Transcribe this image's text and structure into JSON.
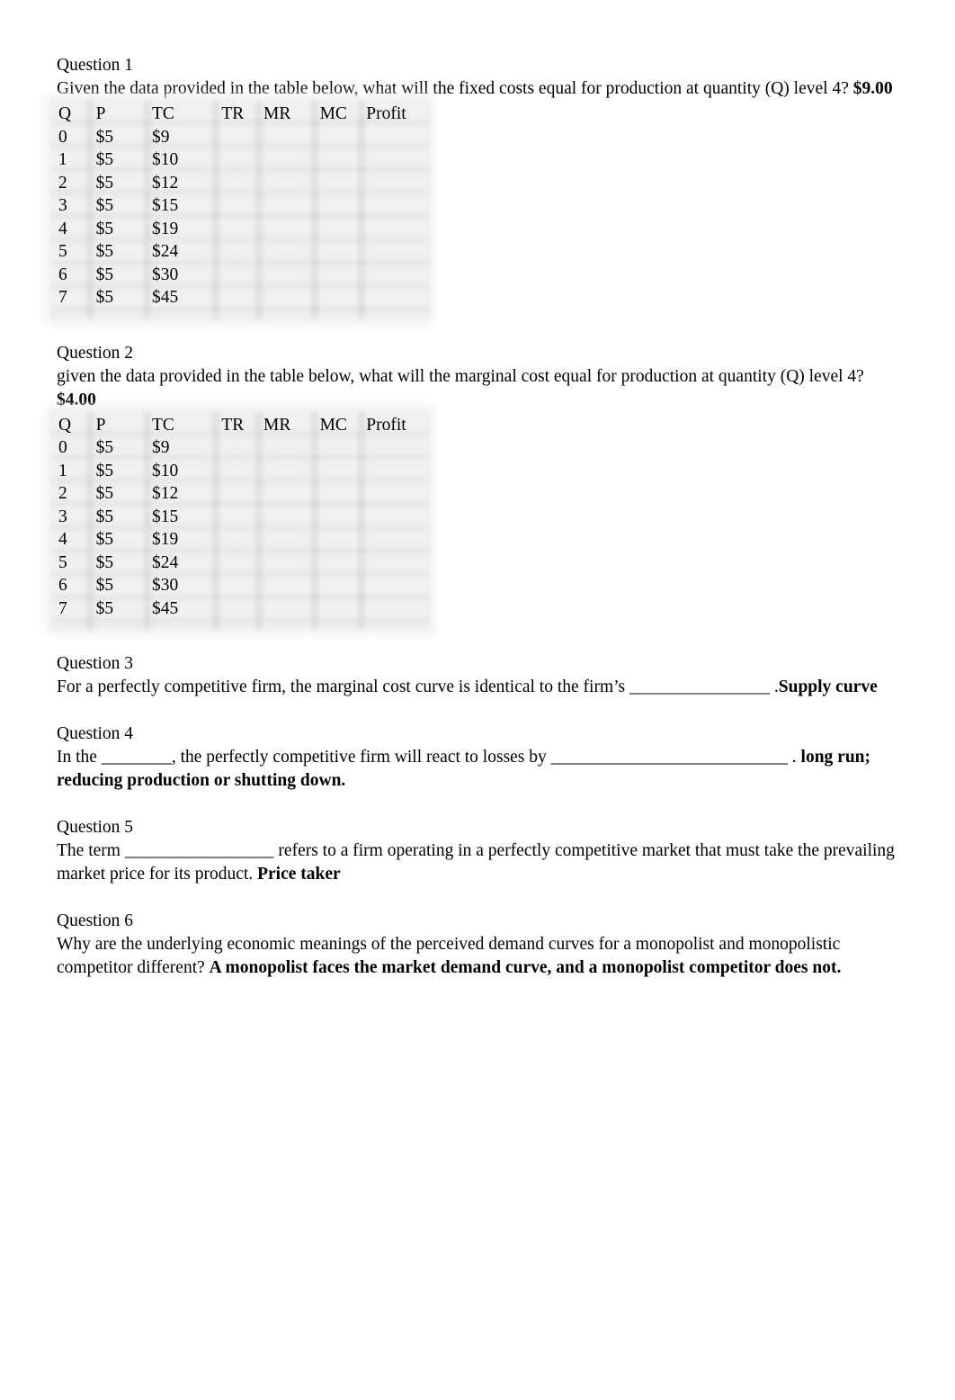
{
  "questions": [
    {
      "title": "Question 1",
      "text": "Given the data provided in the table below, what will the fixed costs equal for production at quantity (Q) level 4?",
      "answer": "$9.00"
    },
    {
      "title": "Question 2",
      "text": "given the data provided in the table below, what will the marginal cost equal for production at quantity (Q) level 4?",
      "answer": "$4.00"
    },
    {
      "title": "Question 3",
      "text": "For a perfectly competitive firm, the marginal cost curve is identical to the firm’s ________________ .",
      "answer": "Supply curve"
    },
    {
      "title": "Question 4",
      "text": "In the ________, the perfectly competitive firm will react to losses by ___________________________ .",
      "answer": "long run; reducing production or shutting down."
    },
    {
      "title": "Question 5",
      "text": "The term _________________ refers to a firm operating in a perfectly competitive market that must take the prevailing market price for its product.",
      "answer": "Price taker"
    },
    {
      "title": "Question 6",
      "text": "Why are the underlying economic meanings of the perceived demand curves for a monopolist and monopolistic competitor different?",
      "answer": "A monopolist faces the market demand curve, and a monopolist competitor does not."
    }
  ],
  "table": {
    "headers": [
      "Q",
      "P",
      "TC",
      "TR",
      "MR",
      "MC",
      "Profit"
    ],
    "rows": [
      [
        "0",
        "$5",
        "$9",
        "",
        "",
        "",
        ""
      ],
      [
        "1",
        "$5",
        "$10",
        "",
        "",
        "",
        ""
      ],
      [
        "2",
        "$5",
        "$12",
        "",
        "",
        "",
        ""
      ],
      [
        "3",
        "$5",
        "$15",
        "",
        "",
        "",
        ""
      ],
      [
        "4",
        "$5",
        "$19",
        "",
        "",
        "",
        ""
      ],
      [
        "5",
        "$5",
        "$24",
        "",
        "",
        "",
        ""
      ],
      [
        "6",
        "$5",
        "$30",
        "",
        "",
        "",
        ""
      ],
      [
        "7",
        "$5",
        "$45",
        "",
        "",
        "",
        ""
      ]
    ]
  }
}
